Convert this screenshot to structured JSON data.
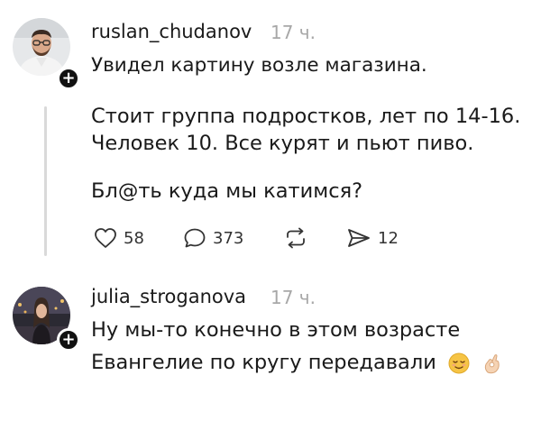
{
  "post": {
    "username": "ruslan_chudanov",
    "time": "17 ч.",
    "lines": [
      "Увидел картину возле магазина.",
      "Стоит группа подростков, лет по 14-16.",
      "Человек 10. Все курят и пьют пиво.",
      "Бл@ть куда мы катимся?"
    ],
    "actions": {
      "likes": "58",
      "comments": "373",
      "reposts": "",
      "shares": "12"
    }
  },
  "reply": {
    "username": "julia_stroganova",
    "time": "17 ч.",
    "lines": [
      "Ну мы-то конечно в этом возрасте",
      "Евангелие по кругу передавали"
    ],
    "emojis": [
      "relieved-face",
      "ok-hand"
    ]
  },
  "colors": {
    "text": "#1a1a1a",
    "muted": "#a8a8a8",
    "thread_line": "#d9d9d9",
    "badge": "#111111"
  }
}
